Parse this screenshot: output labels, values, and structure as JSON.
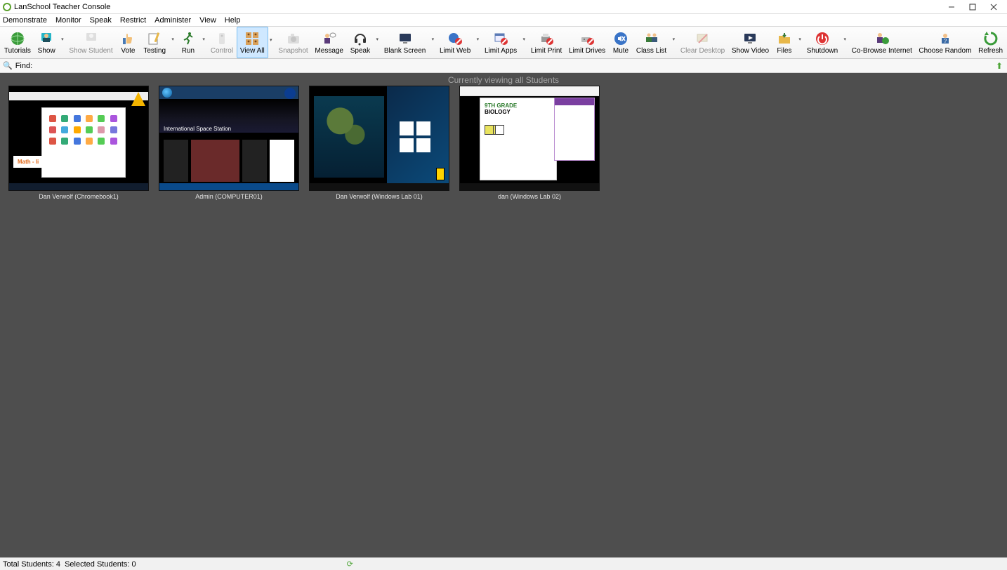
{
  "window": {
    "title": "LanSchool Teacher Console"
  },
  "menu": [
    "Demonstrate",
    "Monitor",
    "Speak",
    "Restrict",
    "Administer",
    "View",
    "Help"
  ],
  "toolbar": [
    {
      "id": "tutorials",
      "label": "Tutorials",
      "icon": "globe",
      "dd": false,
      "disabled": false
    },
    {
      "id": "show",
      "label": "Show",
      "icon": "person-cyan",
      "dd": true,
      "disabled": false
    },
    {
      "id": "show-student",
      "label": "Show Student",
      "icon": "person-gray",
      "dd": false,
      "disabled": true
    },
    {
      "id": "vote",
      "label": "Vote",
      "icon": "thumbs-up",
      "dd": false,
      "disabled": false
    },
    {
      "id": "testing",
      "label": "Testing",
      "icon": "pencil-paper",
      "dd": true,
      "disabled": false
    },
    {
      "id": "run",
      "label": "Run",
      "icon": "runner",
      "dd": true,
      "disabled": false
    },
    {
      "id": "control",
      "label": "Control",
      "icon": "remote",
      "dd": false,
      "disabled": true
    },
    {
      "id": "view-all",
      "label": "View All",
      "icon": "people-grid",
      "dd": true,
      "disabled": false,
      "selected": true
    },
    {
      "id": "snapshot",
      "label": "Snapshot",
      "icon": "camera",
      "dd": false,
      "disabled": true
    },
    {
      "id": "message",
      "label": "Message",
      "icon": "person-bubble",
      "dd": false,
      "disabled": false
    },
    {
      "id": "speak",
      "label": "Speak",
      "icon": "headset",
      "dd": true,
      "disabled": false
    },
    {
      "id": "blank-screen",
      "label": "Blank Screen",
      "icon": "monitor-blank",
      "dd": true,
      "disabled": false
    },
    {
      "id": "limit-web",
      "label": "Limit Web",
      "icon": "globe-block",
      "dd": true,
      "disabled": false
    },
    {
      "id": "limit-apps",
      "label": "Limit Apps",
      "icon": "window-block",
      "dd": true,
      "disabled": false
    },
    {
      "id": "limit-print",
      "label": "Limit Print",
      "icon": "printer-block",
      "dd": false,
      "disabled": false
    },
    {
      "id": "limit-drives",
      "label": "Limit Drives",
      "icon": "drive-block",
      "dd": false,
      "disabled": false
    },
    {
      "id": "mute",
      "label": "Mute",
      "icon": "speaker-mute",
      "dd": false,
      "disabled": false
    },
    {
      "id": "class-list",
      "label": "Class List",
      "icon": "people-list",
      "dd": true,
      "disabled": false
    },
    {
      "id": "clear-desktop",
      "label": "Clear Desktop",
      "icon": "desk-clear",
      "dd": false,
      "disabled": true
    },
    {
      "id": "show-video",
      "label": "Show Video",
      "icon": "monitor-play",
      "dd": false,
      "disabled": false
    },
    {
      "id": "files",
      "label": "Files",
      "icon": "folder-arrow",
      "dd": true,
      "disabled": false
    },
    {
      "id": "shutdown",
      "label": "Shutdown",
      "icon": "power",
      "dd": true,
      "disabled": false
    },
    {
      "id": "cobrowse",
      "label": "Co-Browse Internet",
      "icon": "person-globe",
      "dd": false,
      "disabled": false
    },
    {
      "id": "choose-random",
      "label": "Choose Random",
      "icon": "person-random",
      "dd": false,
      "disabled": false
    },
    {
      "id": "refresh",
      "label": "Refresh",
      "icon": "refresh",
      "dd": false,
      "disabled": false
    }
  ],
  "find": {
    "label": "Find:",
    "value": ""
  },
  "banner": "Currently viewing all Students",
  "students": [
    {
      "caption": "Dan Verwolf (Chromebook1)",
      "kind": "chrome",
      "extra": {
        "mathLabel": "Math - li"
      }
    },
    {
      "caption": "Admin (COMPUTER01)",
      "kind": "iss",
      "extra": {
        "issLabel": "International Space Station"
      }
    },
    {
      "caption": "Dan Verwolf (Windows Lab 01)",
      "kind": "winmap"
    },
    {
      "caption": "dan (Windows Lab 02)",
      "kind": "biology",
      "extra": {
        "gradeLabel": "9TH GRADE",
        "bioLabel": "BIOLOGY"
      }
    }
  ],
  "status": {
    "total_label": "Total Students:",
    "total": 4,
    "selected_label": "Selected Students:",
    "selected": 0
  }
}
